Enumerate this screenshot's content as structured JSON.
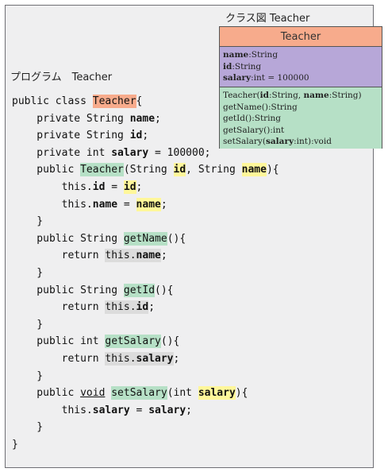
{
  "uml_caption": "クラス図 Teacher",
  "uml": {
    "class_name": "Teacher",
    "attr1_name": "name",
    "attr1_type": ":String",
    "attr2_name": "id",
    "attr2_type": ":String",
    "attr3_name": "salary",
    "attr3_type": ":int = 100000",
    "op1_a": "Teacher(",
    "op1_b": "id",
    "op1_c": ":String, ",
    "op1_d": "name",
    "op1_e": ":String)",
    "op2": "getName():String",
    "op3": "getId():String",
    "op4": "getSalary():int",
    "op5_a": "setSalary(",
    "op5_b": "salary",
    "op5_c": ":int):void"
  },
  "program_caption": "プログラム　Teacher",
  "code": {
    "l1_a": "public class ",
    "l1_b": "Teacher",
    "l1_c": "{",
    "l2_a": "    private String ",
    "l2_b": "name",
    "l2_c": ";",
    "l3_a": "    private String ",
    "l3_b": "id",
    "l3_c": ";",
    "l4_a": "    private int ",
    "l4_b": "salary",
    "l4_c": " = 100000;",
    "l5_a": "    public ",
    "l5_b": "Teacher",
    "l5_c": "(String ",
    "l5_d": "id",
    "l5_e": ", String ",
    "l5_f": "name",
    "l5_g": "){",
    "l6_a": "        this.",
    "l6_b": "id",
    "l6_c": " = ",
    "l6_d": "id",
    "l6_e": ";",
    "l7_a": "        this.",
    "l7_b": "name",
    "l7_c": " = ",
    "l7_d": "name",
    "l7_e": ";",
    "l8": "    }",
    "l9_a": "    public String ",
    "l9_b": "getName",
    "l9_c": "(){",
    "l10_a": "        return ",
    "l10_b": "this.",
    "l10_c": "name",
    "l10_d": ";",
    "l11": "    }",
    "l12_a": "    public String ",
    "l12_b": "getId",
    "l12_c": "(){",
    "l13_a": "        return ",
    "l13_b": "this.",
    "l13_c": "id",
    "l13_d": ";",
    "l14": "    }",
    "l15_a": "    public int ",
    "l15_b": "getSalary",
    "l15_c": "(){",
    "l16_a": "        return ",
    "l16_b": "this.",
    "l16_c": "salary",
    "l16_d": ";",
    "l17": "    }",
    "l18_a": "    public ",
    "l18_b": "void",
    "l18_c": " ",
    "l18_d": "setSalary",
    "l18_e": "(int ",
    "l18_f": "salary",
    "l18_g": "){",
    "l19_a": "        this.",
    "l19_b": "salary",
    "l19_c": " = ",
    "l19_d": "salary",
    "l19_e": ";",
    "l20": "    }",
    "l21": "}"
  },
  "colors": {
    "class_name_fill": "#f7ab8c",
    "attributes_fill": "#b7a7d8",
    "operations_fill": "#b6e0c6",
    "param_highlight": "#fff79a",
    "return_highlight": "#dcdcdc",
    "panel_bg": "#efeff0"
  }
}
